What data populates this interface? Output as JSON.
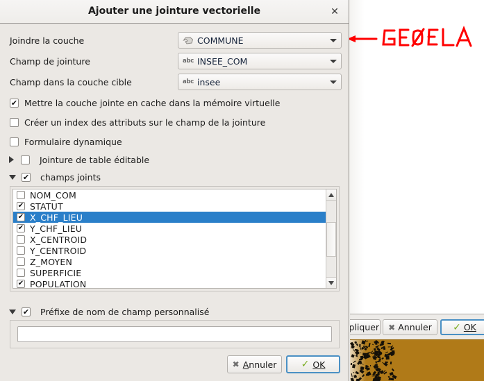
{
  "dialog": {
    "title": "Ajouter une jointure vectorielle",
    "close_label": "✕",
    "rows": [
      {
        "label": "Joindre la couche",
        "value": "COMMUNE",
        "icon": "polygon-layer-icon"
      },
      {
        "label": "Champ de jointure",
        "value": "INSEE_COM",
        "icon": "abc-field-icon"
      },
      {
        "label": "Champ dans la couche cible",
        "value": "insee",
        "icon": "abc-field-icon"
      }
    ],
    "options": [
      {
        "label": "Mettre la couche jointe en cache dans la mémoire virtuelle",
        "checked": true
      },
      {
        "label": "Créer un index des attributs sur le champ de la jointure",
        "checked": false
      },
      {
        "label": "Formulaire dynamique",
        "checked": false
      }
    ],
    "collapsibles": [
      {
        "label": "Jointure de table éditable",
        "checked": false,
        "expanded": false
      },
      {
        "label": "champs joints",
        "checked": true,
        "expanded": true
      }
    ],
    "field_list": [
      {
        "name": "NOM_COM",
        "checked": false,
        "selected": false
      },
      {
        "name": "STATUT",
        "checked": true,
        "selected": false
      },
      {
        "name": "X_CHF_LIEU",
        "checked": true,
        "selected": true
      },
      {
        "name": "Y_CHF_LIEU",
        "checked": true,
        "selected": false
      },
      {
        "name": "X_CENTROID",
        "checked": false,
        "selected": false
      },
      {
        "name": "Y_CENTROID",
        "checked": false,
        "selected": false
      },
      {
        "name": "Z_MOYEN",
        "checked": false,
        "selected": false
      },
      {
        "name": "SUPERFICIE",
        "checked": false,
        "selected": false
      },
      {
        "name": "POPULATION",
        "checked": true,
        "selected": false
      }
    ],
    "prefix": {
      "label": "Préfixe de nom de champ personnalisé",
      "checked": true,
      "expanded": true,
      "value": "",
      "placeholder": ""
    },
    "buttons": {
      "cancel": "Annuler",
      "ok": "OK"
    },
    "check_glyph": "✔",
    "scrollbar": {
      "up": "▲",
      "down": "▼"
    }
  },
  "background": {
    "buttons": {
      "apply": "Appliquer",
      "cancel": "Annuler",
      "ok": "OK"
    },
    "map_color": "#b07a18"
  },
  "annotation": {
    "text": "GEOFLA",
    "color": "#ff0000"
  }
}
